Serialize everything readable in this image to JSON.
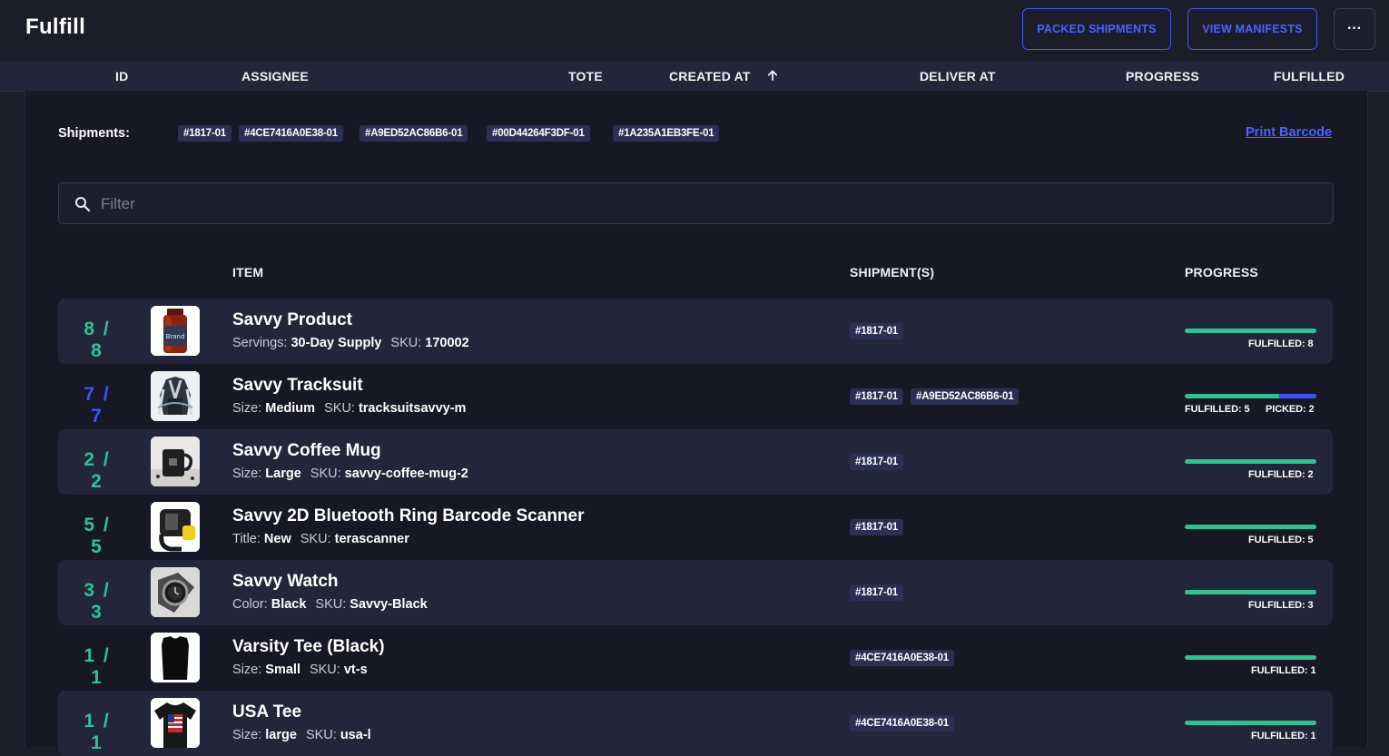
{
  "app": {
    "title": "Fulfill"
  },
  "actions": {
    "packed_label": "PACKED SHIPMENTS",
    "manifests_label": "VIEW MANIFESTS",
    "more_label": "···"
  },
  "columns": {
    "id": "ID",
    "assignee": "ASSIGNEE",
    "tote": "TOTE",
    "created_at": "CREATED AT",
    "deliver_at": "DELIVER AT",
    "progress": "PROGRESS",
    "fulfilled": "FULFILLED",
    "sort_icon": "arrow-up-icon"
  },
  "detail": {
    "shipments_label": "Shipments:",
    "shipments": [
      "#1817-01",
      "#4CE7416A0E38-01",
      "#A9ED52AC86B6-01",
      "#00D44264F3DF-01",
      "#1A235A1EB3FE-01"
    ],
    "print_label": "Print Barcode",
    "filter_placeholder": "Filter",
    "filter_value": "",
    "table_headers": {
      "item": "ITEM",
      "shipments": "SHIPMENT(S)",
      "progress": "PROGRESS"
    }
  },
  "colors": {
    "accent": "#4a63ff",
    "fulfilled": "#2cc393",
    "picked": "#3a53ff"
  },
  "items": [
    {
      "count": "8 / 8",
      "count_color": "#2cc393",
      "thumb": "supplement-bottle",
      "name": "Savvy Product",
      "attr_key": "Servings:",
      "attr_value": "30-Day Supply",
      "sku_key": "SKU:",
      "sku_value": "170002",
      "shipments": [
        "#1817-01"
      ],
      "fulfilled_fraction": 1.0,
      "picked_fraction": 0.0,
      "status_labels": [
        "FULFILLED: 8"
      ]
    },
    {
      "count": "7 / 7",
      "count_color": "#3a53ff",
      "thumb": "tracksuit",
      "name": "Savvy Tracksuit",
      "attr_key": "Size:",
      "attr_value": "Medium",
      "sku_key": "SKU:",
      "sku_value": "tracksuitsavvy-m",
      "shipments": [
        "#1817-01",
        "#A9ED52AC86B6-01"
      ],
      "fulfilled_fraction": 0.714,
      "picked_fraction": 0.286,
      "status_labels": [
        "FULFILLED: 5",
        "PICKED: 2"
      ]
    },
    {
      "count": "2 / 2",
      "count_color": "#2cc393",
      "thumb": "coffee-mug",
      "name": "Savvy Coffee Mug",
      "attr_key": "Size:",
      "attr_value": "Large",
      "sku_key": "SKU:",
      "sku_value": "savvy-coffee-mug-2",
      "shipments": [
        "#1817-01"
      ],
      "fulfilled_fraction": 1.0,
      "picked_fraction": 0.0,
      "status_labels": [
        "FULFILLED: 2"
      ]
    },
    {
      "count": "5 / 5",
      "count_color": "#2cc393",
      "thumb": "ring-scanner",
      "name": "Savvy 2D Bluetooth Ring Barcode Scanner",
      "attr_key": "Title:",
      "attr_value": "New",
      "sku_key": "SKU:",
      "sku_value": "terascanner",
      "shipments": [
        "#1817-01"
      ],
      "fulfilled_fraction": 1.0,
      "picked_fraction": 0.0,
      "status_labels": [
        "FULFILLED: 5"
      ]
    },
    {
      "count": "3 / 3",
      "count_color": "#2cc393",
      "thumb": "watch",
      "name": "Savvy Watch",
      "attr_key": "Color:",
      "attr_value": "Black",
      "sku_key": "SKU:",
      "sku_value": "Savvy-Black",
      "shipments": [
        "#1817-01"
      ],
      "fulfilled_fraction": 1.0,
      "picked_fraction": 0.0,
      "status_labels": [
        "FULFILLED: 3"
      ]
    },
    {
      "count": "1 / 1",
      "count_color": "#2cc393",
      "thumb": "black-tee",
      "name": "Varsity Tee (Black)",
      "attr_key": "Size:",
      "attr_value": "Small",
      "sku_key": "SKU:",
      "sku_value": "vt-s",
      "shipments": [
        "#4CE7416A0E38-01"
      ],
      "fulfilled_fraction": 1.0,
      "picked_fraction": 0.0,
      "status_labels": [
        "FULFILLED: 1"
      ]
    },
    {
      "count": "1 / 1",
      "count_color": "#2cc393",
      "thumb": "usa-tee",
      "name": "USA Tee",
      "attr_key": "Size:",
      "attr_value": "large",
      "sku_key": "SKU:",
      "sku_value": "usa-l",
      "shipments": [
        "#4CE7416A0E38-01"
      ],
      "fulfilled_fraction": 1.0,
      "picked_fraction": 0.0,
      "status_labels": [
        "FULFILLED: 1"
      ]
    }
  ]
}
